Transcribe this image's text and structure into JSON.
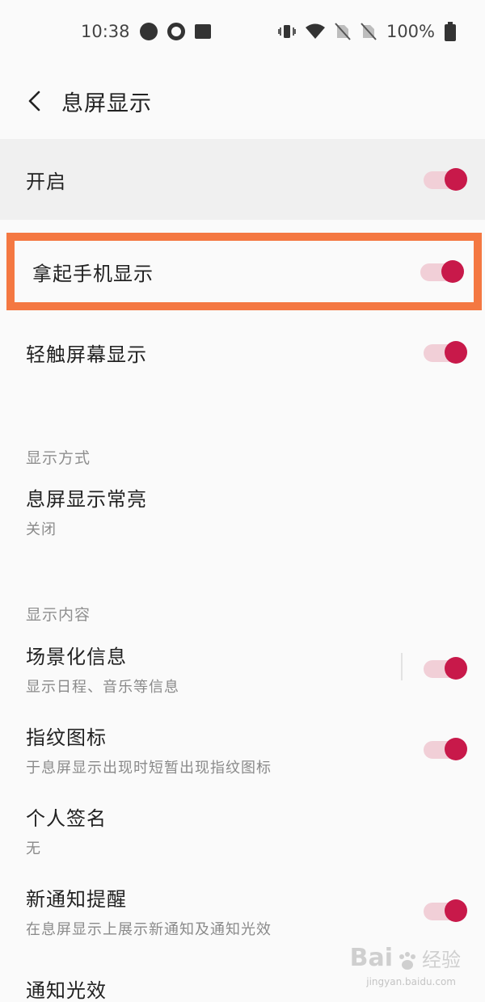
{
  "status_bar": {
    "time": "10:38",
    "battery_text": "100%",
    "left_icons": [
      "notification-dot-icon",
      "q-app-icon",
      "image-icon"
    ],
    "right_icons": [
      "vibrate-icon",
      "wifi-icon",
      "no-sim-icon",
      "no-sim-icon",
      "battery-icon"
    ]
  },
  "header": {
    "back_icon": "back-arrow-icon",
    "title": "息屏显示"
  },
  "master": {
    "title": "开启",
    "enabled": true
  },
  "highlighted_row": {
    "title": "拿起手机显示",
    "enabled": true,
    "highlight_color": "#f47842"
  },
  "tap_row": {
    "title": "轻触屏幕显示",
    "enabled": true
  },
  "sections": {
    "display_mode": {
      "label": "显示方式",
      "items": [
        {
          "title": "息屏显示常亮",
          "subtitle": "关闭"
        }
      ]
    },
    "display_content": {
      "label": "显示内容",
      "items": [
        {
          "title": "场景化信息",
          "subtitle": "显示日程、音乐等信息",
          "enabled": true
        },
        {
          "title": "指纹图标",
          "subtitle": "于息屏显示出现时短暂出现指纹图标",
          "enabled": true
        },
        {
          "title": "个人签名",
          "subtitle": "无"
        },
        {
          "title": "新通知提醒",
          "subtitle": "在息屏显示上展示新通知及通知光效",
          "enabled": true
        },
        {
          "title": "通知光效"
        }
      ]
    }
  },
  "colors": {
    "accent": "#c8194a",
    "track": "#f1cfd7",
    "background": "#fafafa",
    "master_background": "#f0f0f0"
  },
  "watermark": {
    "logo": "Bai",
    "label": "经验",
    "sub": "jingyan.baidu.com"
  }
}
